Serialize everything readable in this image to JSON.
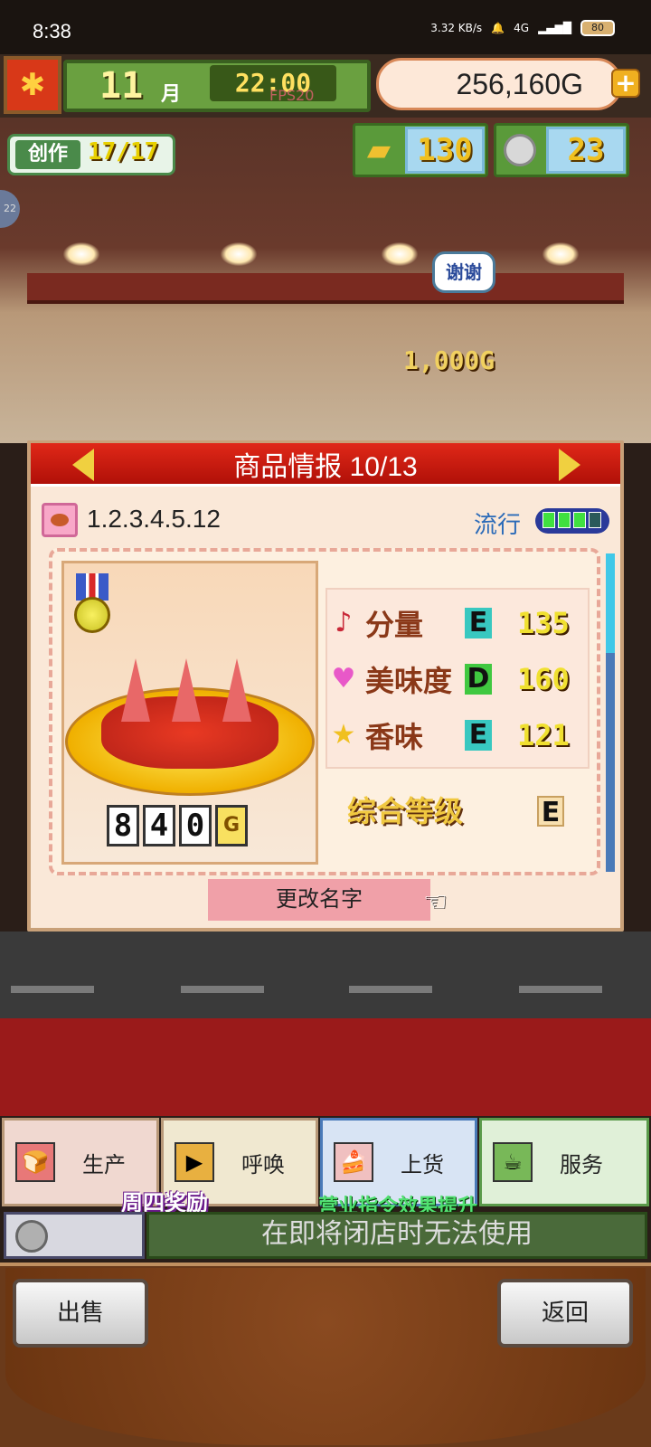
{
  "status_bar": {
    "time": "8:38",
    "net_speed": "3.32 KB/s",
    "network": "4G",
    "battery": "80"
  },
  "hud": {
    "month": "11",
    "month_unit": "月",
    "clock": "22:00",
    "fps": "FPS20",
    "money": "256,160G",
    "create_label": "创作",
    "create_count": "17/17",
    "gold_bars": "130",
    "coins": "23"
  },
  "scene": {
    "speech_bubble": "谢谢",
    "money_popup": "1,000G",
    "side_badge": "22"
  },
  "panel": {
    "title": "商品情报 10/13",
    "product_name": "1.2.3.4.5.12",
    "trend_label": "流行",
    "trend_level": 0.5,
    "price_digits": [
      "8",
      "4",
      "0"
    ],
    "price_unit": "G",
    "stats": [
      {
        "name": "分量",
        "grade": "E",
        "value": "135",
        "icon": "music-note-icon"
      },
      {
        "name": "美味度",
        "grade": "D",
        "value": "160",
        "icon": "heart-icon"
      },
      {
        "name": "香味",
        "grade": "E",
        "value": "121",
        "icon": "star-icon"
      }
    ],
    "overall_label": "综合等级",
    "overall_grade": "E",
    "rename_label": "更改名字"
  },
  "actions": [
    {
      "label": "生产",
      "icon": "bread-icon"
    },
    {
      "label": "呼唤",
      "icon": "megaphone-icon"
    },
    {
      "label": "上货",
      "icon": "cake-icon"
    },
    {
      "label": "服务",
      "icon": "coffee-icon"
    }
  ],
  "promos": {
    "thursday": "周四奖励",
    "boost": "营业指令效果提升"
  },
  "closed_notice": "在即将闭店时无法使用",
  "bottom": {
    "sell": "出售",
    "back": "返回"
  }
}
